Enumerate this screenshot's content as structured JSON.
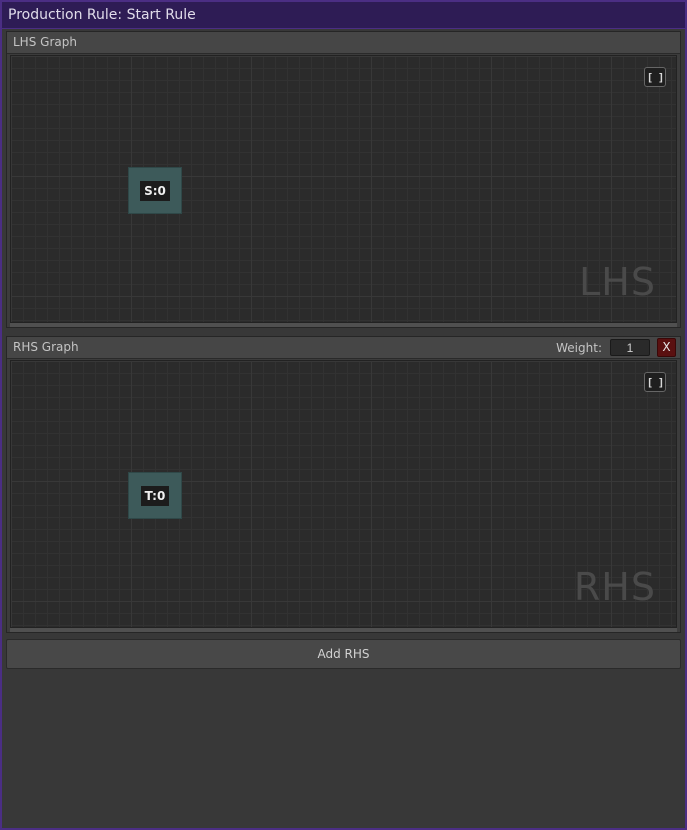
{
  "window": {
    "title": "Production Rule: Start Rule"
  },
  "lhs": {
    "header": "LHS Graph",
    "frame_icon": "[ ]",
    "node_label": "S:0",
    "watermark": "LHS"
  },
  "rhs": {
    "header": "RHS Graph",
    "weight_label": "Weight:",
    "weight_value": "1",
    "remove_label": "X",
    "frame_icon": "[ ]",
    "node_label": "T:0",
    "watermark": "RHS"
  },
  "actions": {
    "add_rhs_label": "Add RHS"
  },
  "colors": {
    "window_border": "#4b2e84",
    "node_fill": "#3d5a5a",
    "remove_button": "#5a1010"
  }
}
